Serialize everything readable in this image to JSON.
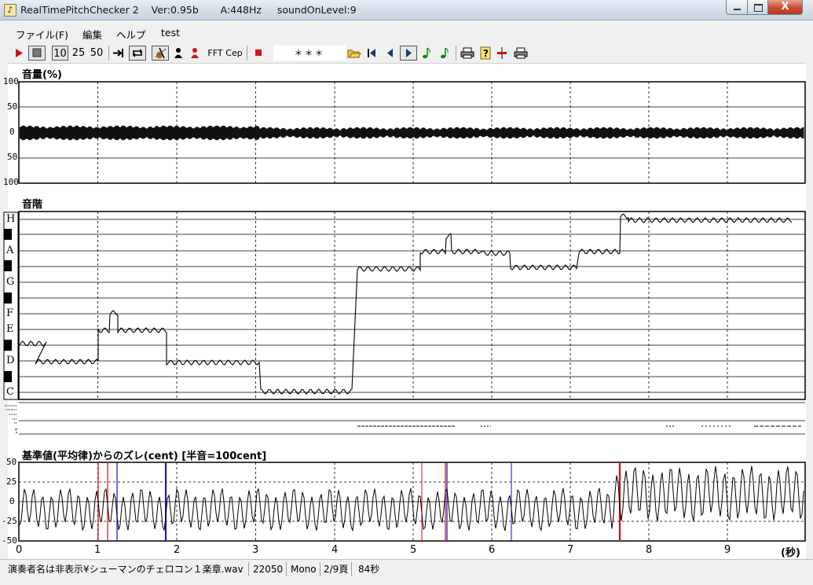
{
  "window": {
    "title": "RealTimePitchChecker 2    Ver:0.95b       A:448Hz     soundOnLevel:9",
    "close_label": "X"
  },
  "menu": [
    "ファイル(F)",
    "編集",
    "ヘルプ",
    "test"
  ],
  "toolbar": {
    "btn_10": "10",
    "btn_25": "25",
    "btn_50": "50",
    "fft_label": "FFT",
    "cep_label": "Cep",
    "status_display": "＊＊＊"
  },
  "volume": {
    "title": "音量(%)",
    "tick_labels": [
      "100",
      "50",
      "0",
      "50",
      "100"
    ]
  },
  "scale": {
    "title": "音階",
    "notes": [
      "H",
      "A",
      "G",
      "F",
      "E",
      "D",
      "C"
    ]
  },
  "deviation": {
    "title": "基準値(平均律)からのズレ(cent) [半音=100cent]",
    "tick_labels": [
      "50",
      "25",
      "0",
      "-25",
      "-50"
    ],
    "time_labels": [
      "0",
      "1",
      "2",
      "3",
      "4",
      "5",
      "6",
      "7",
      "8",
      "9"
    ],
    "time_unit": "(秒)"
  },
  "status": {
    "file": "演奏者名は非表示¥シューマンのチェロコン１楽章.wav",
    "rate": "22050",
    "channels": "Mono",
    "page": "2/9頁",
    "duration": "84秒"
  }
}
